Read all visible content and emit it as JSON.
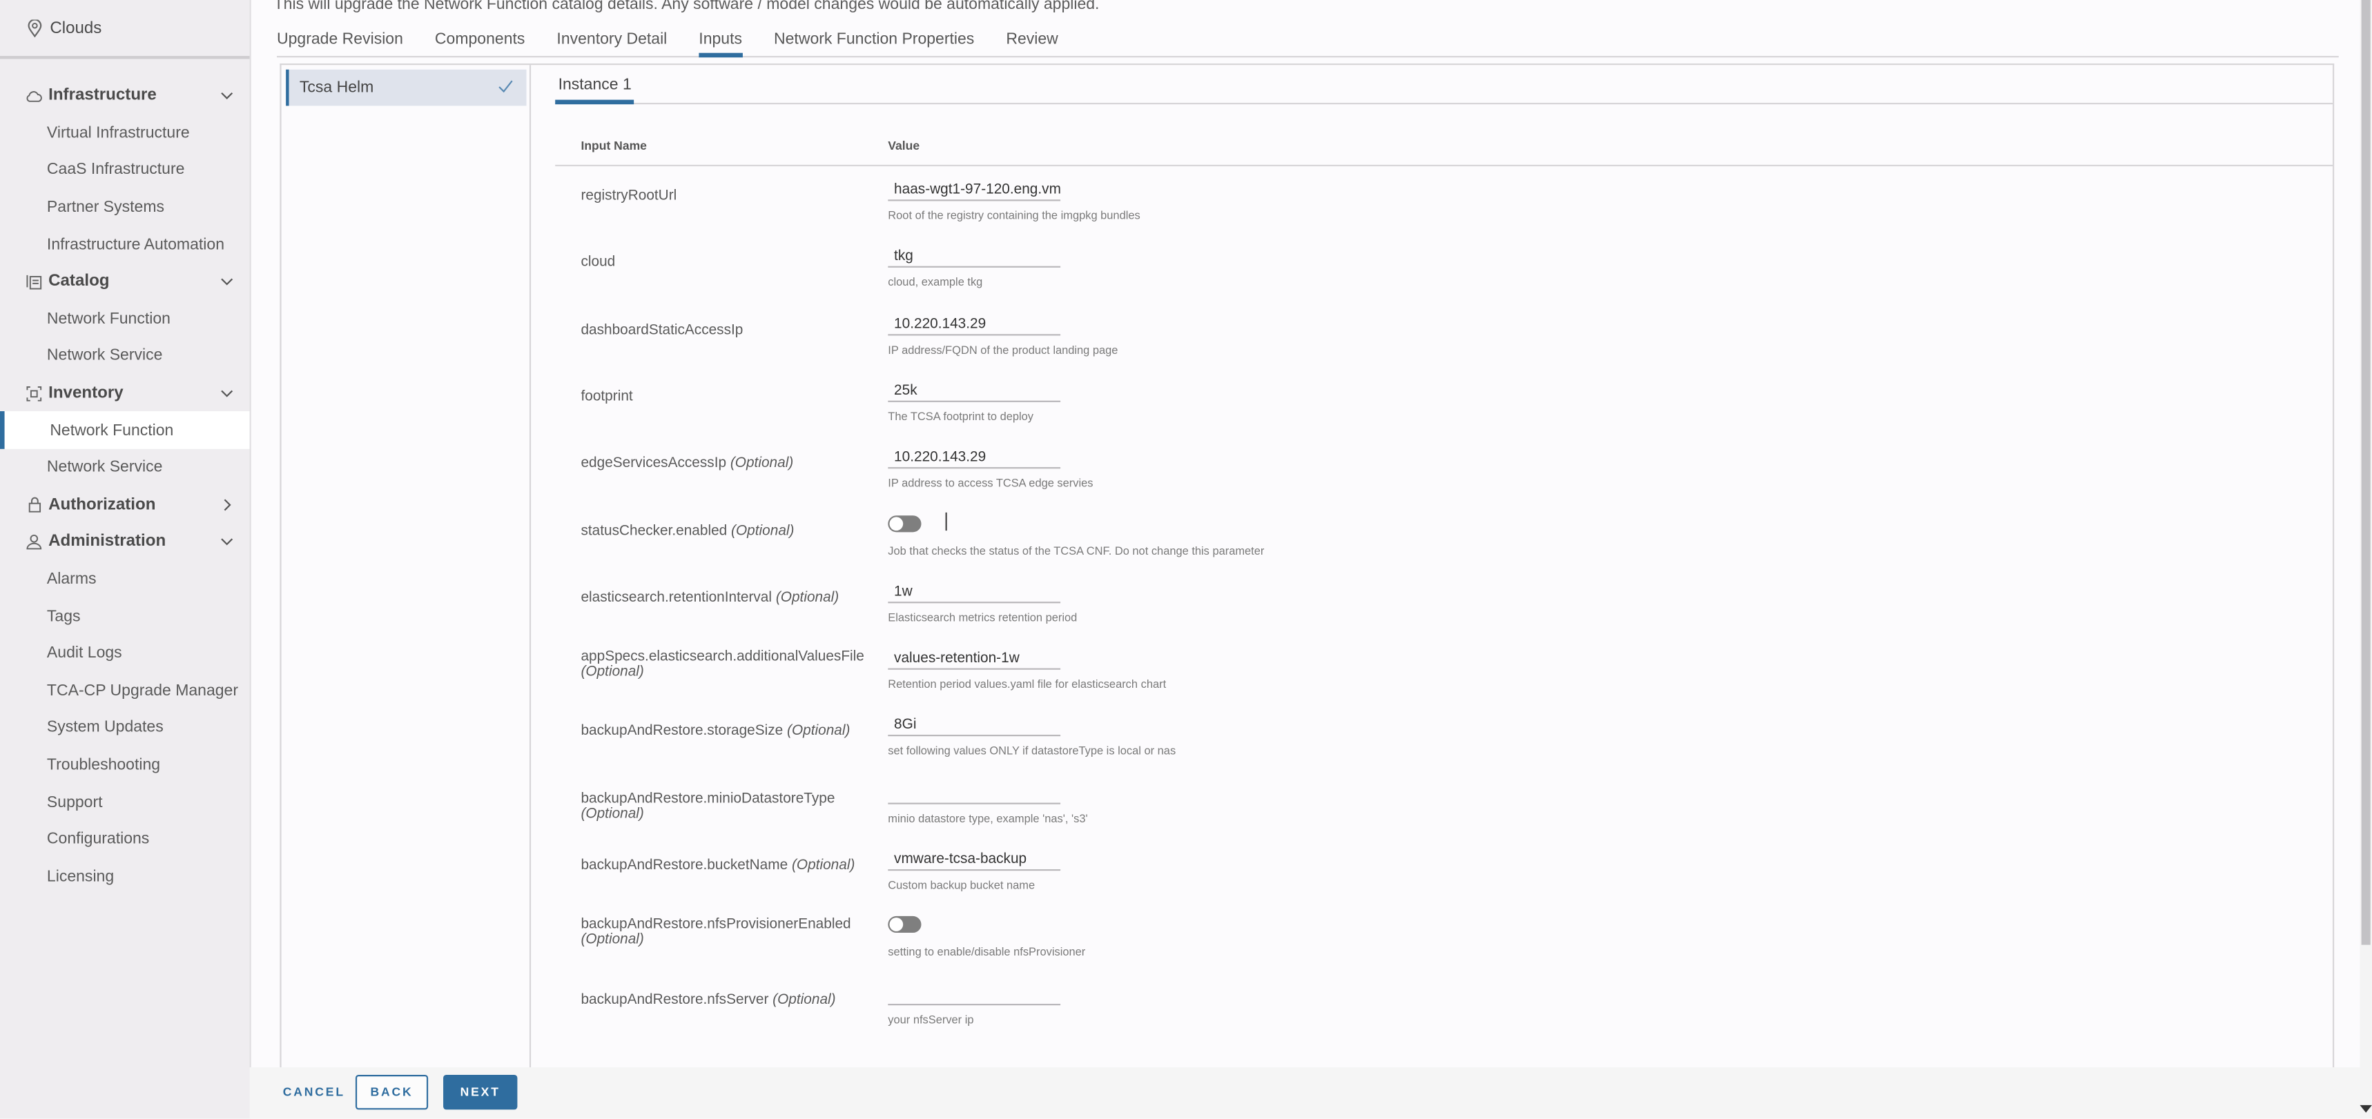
{
  "sidebar": {
    "top": {
      "label": "Clouds",
      "icon": "map-pin-icon"
    },
    "groups": [
      {
        "label": "Infrastructure",
        "icon": "cloud-icon",
        "expanded": true,
        "items": [
          "Virtual Infrastructure",
          "CaaS Infrastructure",
          "Partner Systems",
          "Infrastructure Automation"
        ]
      },
      {
        "label": "Catalog",
        "icon": "catalog-icon",
        "expanded": true,
        "items": [
          "Network Function",
          "Network Service"
        ]
      },
      {
        "label": "Inventory",
        "icon": "inventory-icon",
        "expanded": true,
        "items": [
          "Network Function",
          "Network Service"
        ],
        "active_item": "Network Function"
      },
      {
        "label": "Authorization",
        "icon": "lock-icon",
        "expanded": false,
        "items": []
      },
      {
        "label": "Administration",
        "icon": "user-icon",
        "expanded": true,
        "items": [
          "Alarms",
          "Tags",
          "Audit Logs",
          "TCA-CP Upgrade Manager",
          "System Updates",
          "Troubleshooting",
          "Support",
          "Configurations",
          "Licensing"
        ]
      }
    ]
  },
  "header": {
    "description": "This will upgrade the Network Function catalog details. Any software / model changes would be automatically applied."
  },
  "tabs": [
    {
      "label": "Upgrade Revision",
      "active": false
    },
    {
      "label": "Components",
      "active": false
    },
    {
      "label": "Inventory Detail",
      "active": false
    },
    {
      "label": "Inputs",
      "active": true
    },
    {
      "label": "Network Function Properties",
      "active": false
    },
    {
      "label": "Review",
      "active": false
    }
  ],
  "left_nav": {
    "item": "Tcsa Helm",
    "status_icon": "check-icon"
  },
  "instance_tab": "Instance 1",
  "grid": {
    "headers": {
      "name": "Input Name",
      "value": "Value"
    },
    "optional_label": "(Optional)",
    "rows": [
      {
        "name": "registryRootUrl",
        "optional": false,
        "type": "text",
        "value": "haas-wgt1-97-120.eng.vm",
        "help": "Root of the registry containing the imgpkg bundles"
      },
      {
        "name": "cloud",
        "optional": false,
        "type": "text",
        "value": "tkg",
        "help": "cloud, example tkg"
      },
      {
        "name": "dashboardStaticAccessIp",
        "optional": false,
        "type": "text",
        "value": "10.220.143.29",
        "help": "IP address/FQDN of the product landing page"
      },
      {
        "name": "footprint",
        "optional": false,
        "type": "text",
        "value": "25k",
        "help": "The TCSA footprint to deploy"
      },
      {
        "name": "edgeServicesAccessIp",
        "optional": true,
        "type": "text",
        "value": "10.220.143.29",
        "help": "IP address to access TCSA edge servies"
      },
      {
        "name": "statusChecker.enabled",
        "optional": true,
        "type": "toggle",
        "value": false,
        "help": "Job that checks the status of the TCSA CNF. Do not change this parameter"
      },
      {
        "name": "elasticsearch.retentionInterval",
        "optional": true,
        "type": "text",
        "value": "1w",
        "help": "Elasticsearch metrics retention period"
      },
      {
        "name": "appSpecs.elasticsearch.additionalValuesFile",
        "optional": true,
        "type": "text",
        "value": "values-retention-1w",
        "help": "Retention period values.yaml file for elasticsearch chart"
      },
      {
        "name": "backupAndRestore.storageSize",
        "optional": true,
        "type": "text",
        "value": "8Gi",
        "help": "set following values ONLY if datastoreType is local or nas"
      },
      {
        "name": "backupAndRestore.minioDatastoreType",
        "optional": true,
        "type": "text",
        "value": "",
        "help": "minio datastore type, example 'nas', 's3'"
      },
      {
        "name": "backupAndRestore.bucketName",
        "optional": true,
        "type": "text",
        "value": "vmware-tcsa-backup",
        "help": "Custom backup bucket name"
      },
      {
        "name": "backupAndRestore.nfsProvisionerEnabled",
        "optional": true,
        "type": "toggle",
        "value": false,
        "help": "setting to enable/disable nfsProvisioner"
      },
      {
        "name": "backupAndRestore.nfsServer",
        "optional": true,
        "type": "text",
        "value": "",
        "help": "your nfsServer ip"
      }
    ]
  },
  "footer": {
    "cancel": "CANCEL",
    "back": "BACK",
    "next": "NEXT"
  },
  "colors": {
    "accent": "#2f6d9f",
    "sidebar_bg": "#efedf0",
    "nav_selected_bg": "#dfe3ec",
    "toggle_off": "#7f7f7f"
  }
}
